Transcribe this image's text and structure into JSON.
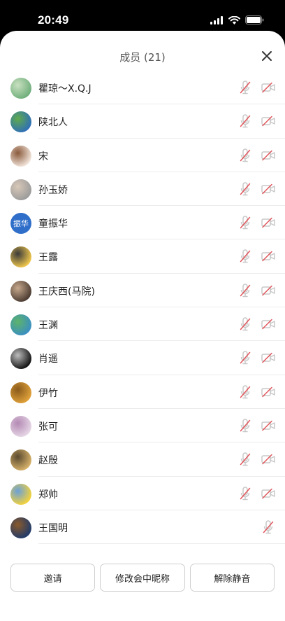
{
  "status": {
    "time": "20:49",
    "icons": [
      "signal-icon",
      "wifi-icon",
      "battery-icon"
    ]
  },
  "sheet": {
    "title": "成员 (21)",
    "close_icon": "close-icon"
  },
  "members": [
    {
      "name": "瞿琼～X.Q.J",
      "avatar_colors": [
        "#6fae7b",
        "#c9e0c0"
      ],
      "avatar_text": "",
      "mic_icon": "mic-off-icon",
      "cam_icon": "camera-off-icon"
    },
    {
      "name": "陕北人",
      "avatar_colors": [
        "#2f6fb8",
        "#5faa4c"
      ],
      "avatar_text": "",
      "mic_icon": "mic-off-icon",
      "cam_icon": "camera-off-icon"
    },
    {
      "name": "宋",
      "avatar_colors": [
        "#f3e6dc",
        "#8a5a3c"
      ],
      "avatar_text": "",
      "mic_icon": "mic-off-icon",
      "cam_icon": "camera-off-icon"
    },
    {
      "name": "孙玉娇",
      "avatar_colors": [
        "#9b9b9b",
        "#d8c8b8"
      ],
      "avatar_text": "",
      "mic_icon": "mic-off-icon",
      "cam_icon": "camera-off-icon"
    },
    {
      "name": "童振华",
      "avatar_colors": [
        "#2f6ec9",
        "#2f6ec9"
      ],
      "avatar_text": "振华",
      "mic_icon": "mic-off-icon",
      "cam_icon": "camera-off-icon"
    },
    {
      "name": "王露",
      "avatar_colors": [
        "#f2c94c",
        "#3a3a3a"
      ],
      "avatar_text": "",
      "mic_icon": "mic-off-icon",
      "cam_icon": "camera-off-icon"
    },
    {
      "name": "王庆西(马院)",
      "avatar_colors": [
        "#4a3a30",
        "#c7a98d"
      ],
      "avatar_text": "",
      "mic_icon": "mic-off-icon",
      "cam_icon": "camera-off-icon"
    },
    {
      "name": "王渊",
      "avatar_colors": [
        "#3a8fc2",
        "#5db36a"
      ],
      "avatar_text": "",
      "mic_icon": "mic-off-icon",
      "cam_icon": "camera-off-icon"
    },
    {
      "name": "肖遥",
      "avatar_colors": [
        "#111111",
        "#bdbdbd"
      ],
      "avatar_text": "",
      "mic_icon": "mic-off-icon",
      "cam_icon": "camera-off-icon"
    },
    {
      "name": "伊竹",
      "avatar_colors": [
        "#e0a23a",
        "#8a5a1c"
      ],
      "avatar_text": "",
      "mic_icon": "mic-off-icon",
      "cam_icon": "camera-off-icon"
    },
    {
      "name": "张可",
      "avatar_colors": [
        "#e6d7e6",
        "#b48ab4"
      ],
      "avatar_text": "",
      "mic_icon": "mic-off-icon",
      "cam_icon": "camera-off-icon"
    },
    {
      "name": "赵殷",
      "avatar_colors": [
        "#d8b26a",
        "#5a4a30"
      ],
      "avatar_text": "",
      "mic_icon": "mic-off-icon",
      "cam_icon": "camera-off-icon"
    },
    {
      "name": "郑帅",
      "avatar_colors": [
        "#f5d33a",
        "#6aa0d8"
      ],
      "avatar_text": "",
      "mic_icon": "mic-off-icon",
      "cam_icon": "camera-off-icon"
    },
    {
      "name": "王国明",
      "avatar_colors": [
        "#1f3a6a",
        "#8a5a2a"
      ],
      "avatar_text": "",
      "mic_icon": "mic-off-icon",
      "cam_icon": ""
    }
  ],
  "footer": {
    "invite_label": "邀请",
    "rename_label": "修改会中昵称",
    "unmute_label": "解除静音"
  },
  "colors": {
    "muted_icon": "#c8c8c8",
    "slash": "#e0565b"
  }
}
